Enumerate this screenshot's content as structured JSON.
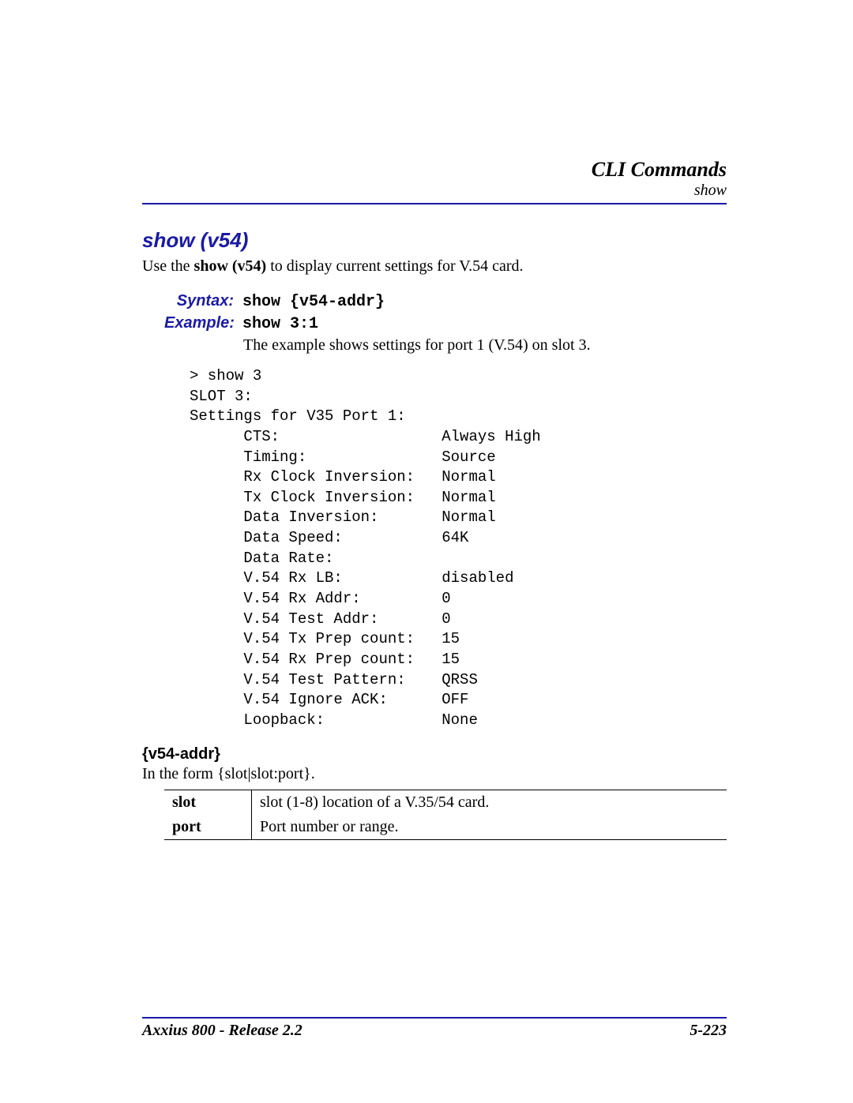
{
  "header": {
    "chapter": "CLI Commands",
    "section": "show"
  },
  "title": "show (v54)",
  "intro_1": "Use the ",
  "intro_bold": "show (v54)",
  "intro_2": " to display current settings for V.54 card.",
  "syntax": {
    "label": "Syntax:",
    "value": "show {v54-addr}"
  },
  "example": {
    "label": "Example:",
    "value": "show 3:1",
    "desc": "The example shows settings for port 1 (V.54) on slot 3."
  },
  "output": "> show 3\nSLOT 3:\nSettings for V35 Port 1:\n      CTS:                  Always High\n      Timing:               Source\n      Rx Clock Inversion:   Normal\n      Tx Clock Inversion:   Normal\n      Data Inversion:       Normal\n      Data Speed:           64K\n      Data Rate:\n      V.54 Rx LB:           disabled\n      V.54 Rx Addr:         0\n      V.54 Test Addr:       0\n      V.54 Tx Prep count:   15\n      V.54 Rx Prep count:   15\n      V.54 Test Pattern:    QRSS\n      V.54 Ignore ACK:      OFF\n      Loopback:             None",
  "param_section": {
    "heading": "{v54-addr}",
    "desc": "In the form {slot|slot:port}.",
    "rows": [
      {
        "key": "slot",
        "desc": "slot (1-8) location of a V.35/54 card."
      },
      {
        "key": "port",
        "desc": "Port number or range."
      }
    ]
  },
  "footer": {
    "left": "Axxius 800 - Release 2.2",
    "right": "5-223"
  }
}
